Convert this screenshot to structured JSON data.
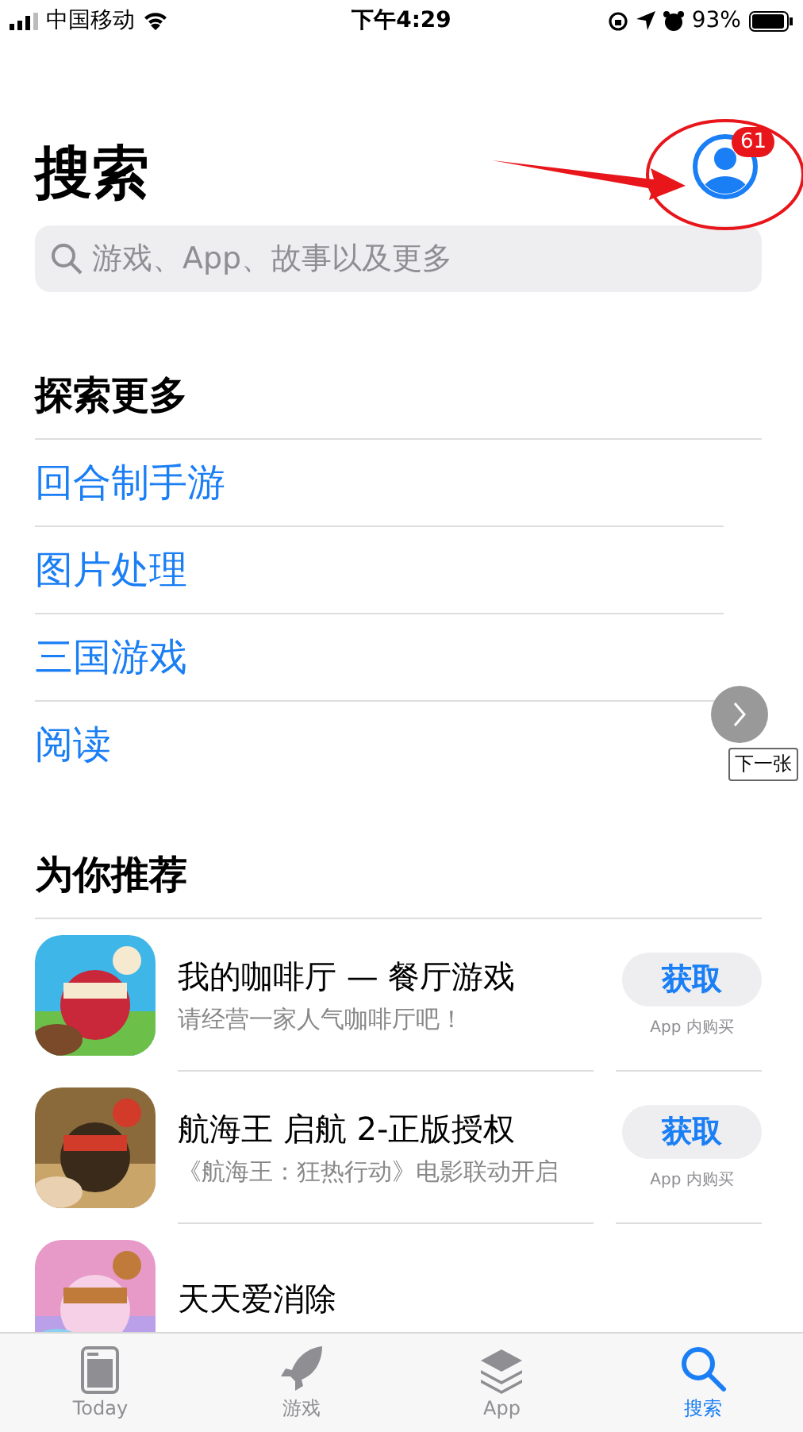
{
  "status_bar": {
    "carrier": "中国移动",
    "time": "下午4:29",
    "battery": "93%"
  },
  "header": {
    "title": "搜索",
    "account_badge": "61"
  },
  "search": {
    "placeholder": "游戏、App、故事以及更多"
  },
  "explore": {
    "heading": "探索更多",
    "links": [
      "回合制手游",
      "图片处理",
      "三国游戏",
      "阅读"
    ]
  },
  "recommend": {
    "heading": "为你推荐",
    "apps": [
      {
        "name": "我的咖啡厅 — 餐厅游戏",
        "subtitle": "请经营一家人气咖啡厅吧！",
        "button": "获取",
        "note": "App 内购买",
        "kind": "picture"
      },
      {
        "name": "航海王 启航 2-正版授权",
        "subtitle": "《航海王：狂热行动》电影联动开启",
        "button": "获取",
        "note": "App 内购买",
        "kind": "picture"
      },
      {
        "name": "天天爱消除",
        "kind": "picture"
      }
    ]
  },
  "slideshow": {
    "next_label": "下一张"
  },
  "tab_bar": [
    {
      "label": "Today",
      "kind": "today",
      "selected": false
    },
    {
      "label": "游戏",
      "kind": "rocket",
      "selected": false
    },
    {
      "label": "App",
      "kind": "stack",
      "selected": false
    },
    {
      "label": "搜索",
      "kind": "search",
      "selected": true
    }
  ]
}
